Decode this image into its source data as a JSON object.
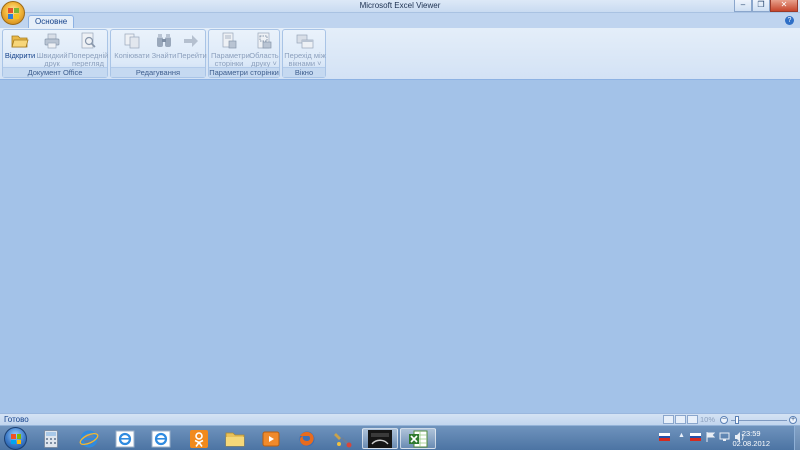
{
  "window": {
    "title": "Microsoft Excel Viewer",
    "minimize_glyph": "–",
    "restore_glyph": "❐",
    "close_glyph": "✕"
  },
  "office_button": {
    "icon": "office-logo-icon"
  },
  "tabs": [
    {
      "label": "Основне",
      "active": true
    }
  ],
  "help": {
    "glyph": "?"
  },
  "ribbon": {
    "groups": [
      {
        "title": "Документ Office",
        "buttons": [
          {
            "label": "Відкрити",
            "icon": "folder-open-icon",
            "enabled": true
          },
          {
            "label": "Швидкий друк",
            "line1": "Швидкий",
            "line2": "друк",
            "icon": "printer-icon",
            "enabled": false
          },
          {
            "label": "Попередній перегляд",
            "line1": "Попередній",
            "line2": "перегляд",
            "icon": "print-preview-icon",
            "enabled": false
          }
        ]
      },
      {
        "title": "Редагування",
        "buttons": [
          {
            "label": "Копіювати",
            "icon": "copy-icon",
            "enabled": false
          },
          {
            "label": "Знайти",
            "icon": "binoculars-icon",
            "enabled": false
          },
          {
            "label": "Перейти",
            "icon": "arrow-right-icon",
            "enabled": false
          }
        ]
      },
      {
        "title": "Параметри сторінки",
        "buttons": [
          {
            "label": "Параметри сторінки",
            "line1": "Параметри",
            "line2": "сторінки",
            "icon": "page-setup-icon",
            "enabled": false
          },
          {
            "label": "Область друку",
            "line1": "Область",
            "line2": "друку ˅",
            "icon": "print-area-icon",
            "enabled": false
          }
        ]
      },
      {
        "title": "Вікно",
        "buttons": [
          {
            "label": "Перехід між вікнами",
            "line1": "Перехід між",
            "line2": "вікнами ˅",
            "icon": "switch-windows-icon",
            "enabled": false
          }
        ]
      }
    ]
  },
  "statusbar": {
    "status": "Готово",
    "zoom_label": "10%",
    "minus_glyph": "−",
    "plus_glyph": "+",
    "zoom_level": 0.1
  },
  "taskbar": {
    "items": [
      {
        "name": "calculator",
        "icon": "calculator-icon"
      },
      {
        "name": "internet-explorer",
        "icon": "ie-icon"
      },
      {
        "name": "internet-explorer-2",
        "icon": "ie-icon"
      },
      {
        "name": "internet-explorer-3",
        "icon": "ie-icon"
      },
      {
        "name": "odnoklassniki",
        "icon": "odnoklassniki-icon"
      },
      {
        "name": "file-explorer",
        "icon": "folder-icon"
      },
      {
        "name": "media-player",
        "icon": "media-player-icon"
      },
      {
        "name": "firefox",
        "icon": "firefox-icon"
      },
      {
        "name": "app-tool",
        "icon": "tool-icon"
      },
      {
        "name": "app-dark",
        "icon": "dark-app-icon"
      },
      {
        "name": "excel-viewer",
        "icon": "excel-icon",
        "active": true
      }
    ],
    "tray": {
      "language_icon": "flag-ru-icon",
      "time": "23:59",
      "date": "02.08.2012"
    }
  },
  "colors": {
    "workspace": "#a3c2e8",
    "ribbon_text": "#15428b",
    "disabled_text": "#8ca0bd"
  }
}
